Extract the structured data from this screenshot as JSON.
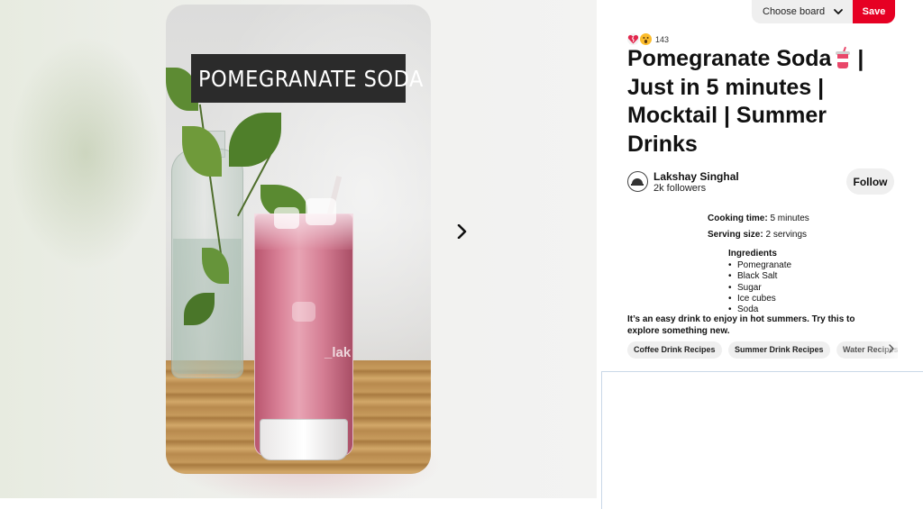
{
  "pin_image": {
    "overlay_title": "POMEGRANATE SODA",
    "watermark": "_lak"
  },
  "header": {
    "board_select_label": "Choose board",
    "save_label": "Save"
  },
  "reactions": {
    "icons": [
      "heart-break-icon",
      "wow-face-icon"
    ],
    "count": "143"
  },
  "pin": {
    "title": "Pomegranate Soda",
    "title_rest": " | Just in 5 minutes | Mocktail | Summer Drinks"
  },
  "creator": {
    "name": "Lakshay Singhal",
    "followers": "2k followers",
    "follow_label": "Follow"
  },
  "recipe": {
    "cooking_time_label": "Cooking time:",
    "cooking_time_value": " 5 minutes",
    "serving_size_label": "Serving size:",
    "serving_size_value": " 2 servings",
    "ingredients_heading": "Ingredients",
    "ingredients": [
      "Pomegranate",
      "Black Salt",
      "Sugar",
      "Ice cubes",
      "Soda"
    ]
  },
  "description": "It’s an easy drink to enjoy in hot summers. Try this to explore something new.",
  "tags": [
    "Coffee Drink Recipes",
    "Summer Drink Recipes",
    "Water Recipes"
  ],
  "colors": {
    "save_red": "#e60023",
    "chip_bg": "#efefef",
    "drink_pink": "#d98197"
  }
}
